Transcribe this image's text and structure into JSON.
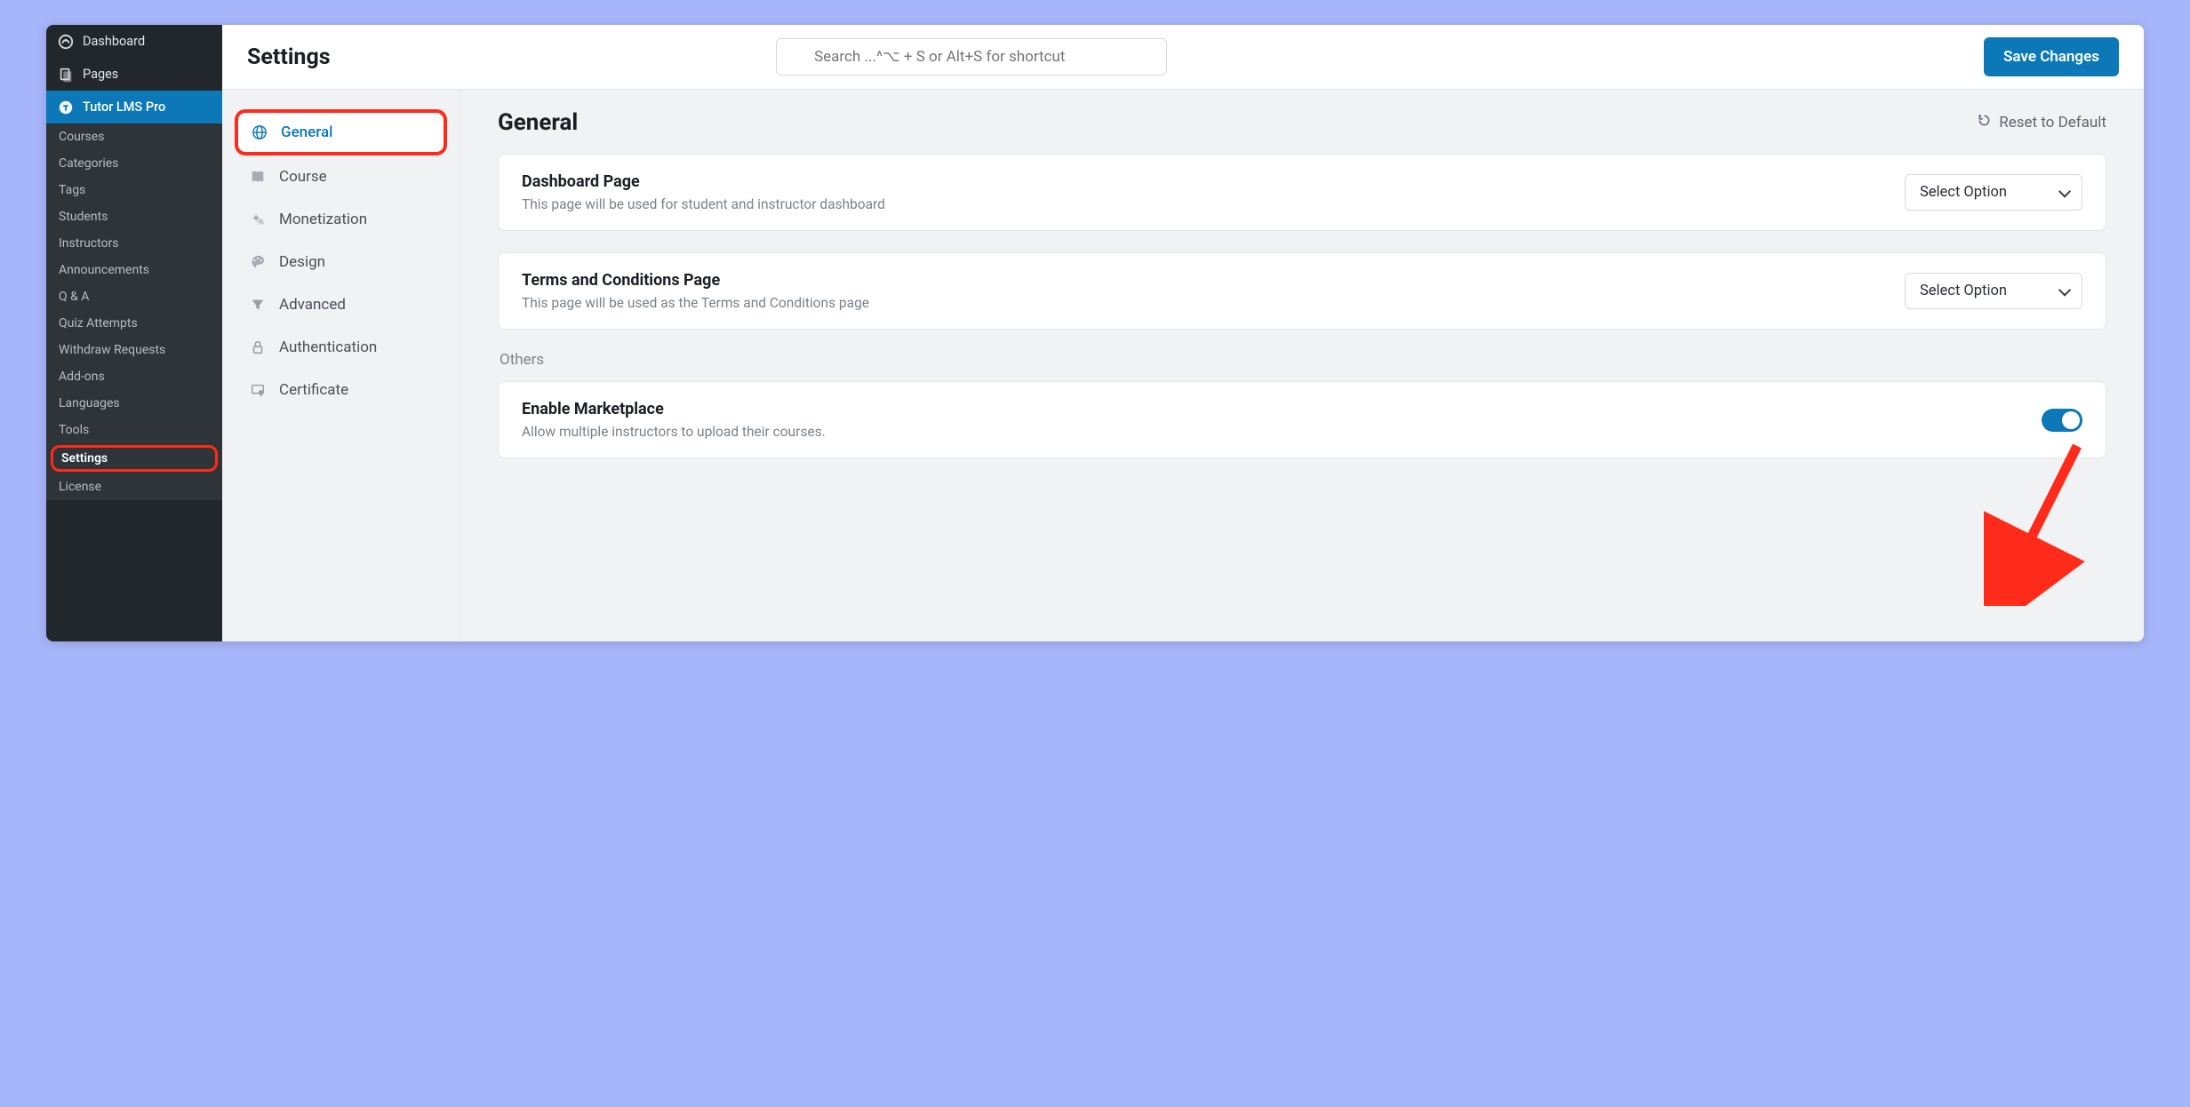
{
  "colors": {
    "accent": "#0c78b8",
    "annotation": "#ff2b1a"
  },
  "wp_sidebar": {
    "items": [
      {
        "label": "Dashboard",
        "icon": "dashboard"
      },
      {
        "label": "Pages",
        "icon": "pages"
      },
      {
        "label": "Tutor LMS Pro",
        "icon": "tutor",
        "active": true
      }
    ],
    "sub_items": [
      {
        "label": "Courses"
      },
      {
        "label": "Categories"
      },
      {
        "label": "Tags"
      },
      {
        "label": "Students"
      },
      {
        "label": "Instructors"
      },
      {
        "label": "Announcements"
      },
      {
        "label": "Q & A"
      },
      {
        "label": "Quiz Attempts"
      },
      {
        "label": "Withdraw Requests"
      },
      {
        "label": "Add-ons"
      },
      {
        "label": "Languages"
      },
      {
        "label": "Tools"
      },
      {
        "label": "Settings",
        "current": true,
        "annotated": true
      },
      {
        "label": "License"
      }
    ]
  },
  "topbar": {
    "title": "Settings",
    "search_placeholder": "Search ...^⌥ + S or Alt+S for shortcut",
    "save_label": "Save Changes"
  },
  "tabs": [
    {
      "label": "General",
      "icon": "globe",
      "active": true,
      "annotated": true
    },
    {
      "label": "Course",
      "icon": "book"
    },
    {
      "label": "Monetization",
      "icon": "money"
    },
    {
      "label": "Design",
      "icon": "palette"
    },
    {
      "label": "Advanced",
      "icon": "filter"
    },
    {
      "label": "Authentication",
      "icon": "lock"
    },
    {
      "label": "Certificate",
      "icon": "certificate"
    }
  ],
  "content": {
    "heading": "General",
    "reset_label": "Reset to Default",
    "cards": [
      {
        "title": "Dashboard Page",
        "description": "This page will be used for student and instructor dashboard",
        "control": "select",
        "value": "Select Option"
      },
      {
        "title": "Terms and Conditions Page",
        "description": "This page will be used as the Terms and Conditions page",
        "control": "select",
        "value": "Select Option"
      }
    ],
    "section_label": "Others",
    "others_card": {
      "title": "Enable Marketplace",
      "description": "Allow multiple instructors to upload their courses.",
      "control": "toggle",
      "value": true,
      "annotated_arrow": true
    }
  }
}
